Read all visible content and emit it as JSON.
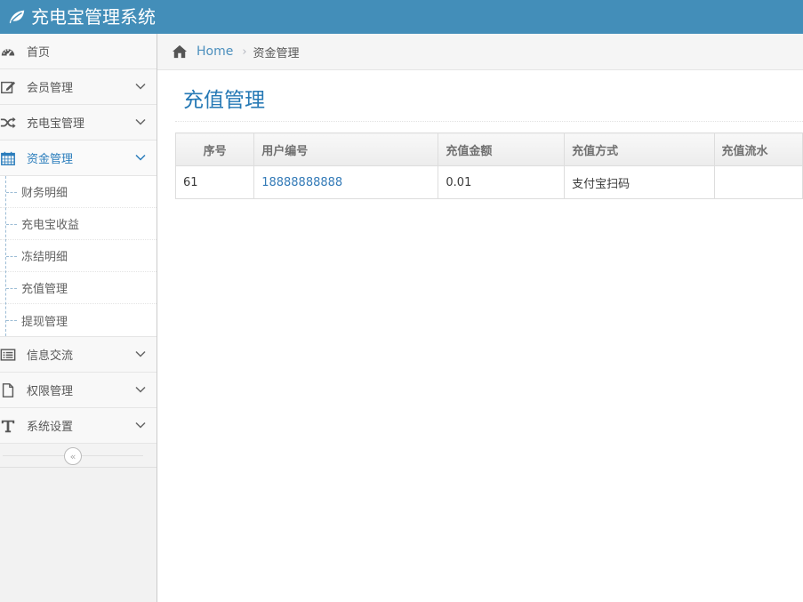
{
  "app": {
    "title": "充电宝管理系统"
  },
  "sidebar": {
    "items": [
      {
        "label": "首页",
        "icon": "dashboard-icon"
      },
      {
        "label": "会员管理",
        "icon": "edit-icon"
      },
      {
        "label": "充电宝管理",
        "icon": "random-icon"
      },
      {
        "label": "资金管理",
        "icon": "calendar-icon"
      },
      {
        "label": "信息交流",
        "icon": "list-alt-icon"
      },
      {
        "label": "权限管理",
        "icon": "file-icon"
      },
      {
        "label": "系统设置",
        "icon": "text-icon"
      }
    ],
    "submenu": [
      {
        "label": "财务明细"
      },
      {
        "label": "充电宝收益"
      },
      {
        "label": "冻结明细"
      },
      {
        "label": "充值管理"
      },
      {
        "label": "提现管理"
      }
    ],
    "collapse_glyph": "«"
  },
  "breadcrumb": {
    "home": "Home",
    "separator": "›",
    "current": "资金管理"
  },
  "page": {
    "title": "充值管理"
  },
  "table": {
    "columns": [
      "序号",
      "用户编号",
      "充值金额",
      "充值方式",
      "充值流水"
    ],
    "rows": [
      [
        "61",
        "18888888888",
        "0.01",
        "支付宝扫码",
        ""
      ]
    ]
  },
  "colors": {
    "navbar": "#438eb9",
    "accent": "#2679b5",
    "link": "#337ab7"
  }
}
